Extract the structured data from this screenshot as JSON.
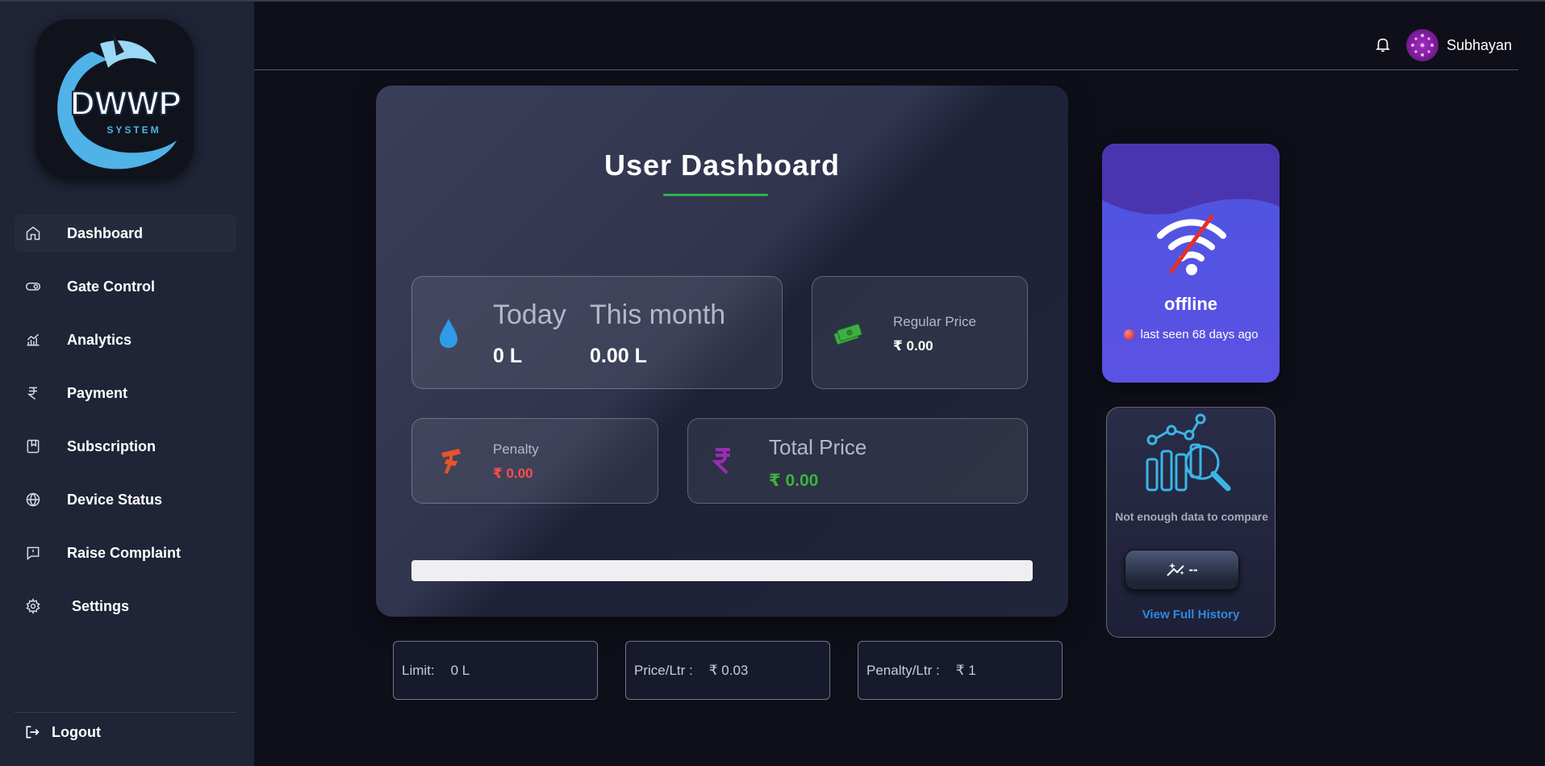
{
  "app": {
    "logo_text": "DWWP",
    "logo_sub": "SYSTEM"
  },
  "sidebar": {
    "items": [
      {
        "label": "Dashboard",
        "icon": "home-icon",
        "active": true
      },
      {
        "label": "Gate Control",
        "icon": "toggle-icon"
      },
      {
        "label": "Analytics",
        "icon": "analytics-icon"
      },
      {
        "label": "Payment",
        "icon": "rupee-icon"
      },
      {
        "label": "Subscription",
        "icon": "bookmark-icon"
      },
      {
        "label": "Device Status",
        "icon": "globe-icon"
      },
      {
        "label": "Raise Complaint",
        "icon": "message-alert-icon"
      },
      {
        "label": "Settings",
        "icon": "gear-icon"
      }
    ],
    "logout": "Logout"
  },
  "header": {
    "username": "Subhayan"
  },
  "dashboard": {
    "title": "User Dashboard",
    "usage": {
      "today_label": "Today",
      "today_value": "0 L",
      "month_label": "This month",
      "month_value": "0.00 L"
    },
    "regular_price": {
      "label": "Regular Price",
      "value": "₹ 0.00"
    },
    "penalty": {
      "label": "Penalty",
      "value": "₹ 0.00"
    },
    "total_price": {
      "label": "Total Price",
      "value": "₹ 0.00"
    },
    "usage_progress": 0
  },
  "info": {
    "limit_label": "Limit:",
    "limit_value": "0 L",
    "price_label": "Price/Ltr :",
    "price_value": "₹ 0.03",
    "penalty_label": "Penalty/Ltr :",
    "penalty_value": "₹ 1"
  },
  "device": {
    "status": "offline",
    "last_seen": "last seen 68 days ago"
  },
  "compare": {
    "message": "Not enough data to compare",
    "button_value": "--",
    "link": "View Full History"
  },
  "colors": {
    "accent_green": "#2fb34a",
    "penalty_red": "#ff4d4d",
    "total_green": "#3cb43c",
    "link_blue": "#2d8ae0"
  }
}
